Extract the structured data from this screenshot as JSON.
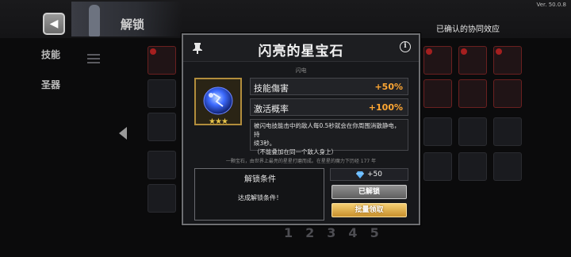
{
  "app": {
    "version": "Ver. 50.0.8",
    "header_title": "解锁",
    "synergy_label": "已确认的协同效应"
  },
  "left_nav": {
    "items": [
      {
        "label": "技能"
      },
      {
        "label": "圣器"
      }
    ]
  },
  "pagination": {
    "pages": [
      "1",
      "2",
      "3",
      "4",
      "5"
    ]
  },
  "modal": {
    "title": "闪亮的星宝石",
    "subtitle": "闪电",
    "item_stars": "★★★",
    "stats": [
      {
        "label": "技能傷害",
        "value": "+50%"
      },
      {
        "label": "激活概率",
        "value": "+100%"
      }
    ],
    "description_lines": [
      "被闪电技能击中的敌人每0.5秒就会在你周围消散静电，持",
      "续3秒。",
      "（不能叠加在同一个敌人身上）"
    ],
    "flavor_text": "一颗宝石，由世界上最亮的星星打磨而成。在星星的魔力下历经 177 年",
    "unlock": {
      "title": "解锁条件",
      "condition": "达成解锁条件！"
    },
    "reward": {
      "amount": "+50",
      "icon": "diamond-icon"
    },
    "buttons": {
      "unlocked": "已解锁",
      "claim_all": "批量领取"
    },
    "colors": {
      "stat_value": "#ffa733",
      "gem_border": "#b28d3c",
      "claim_button": "#e0ad4a"
    }
  }
}
